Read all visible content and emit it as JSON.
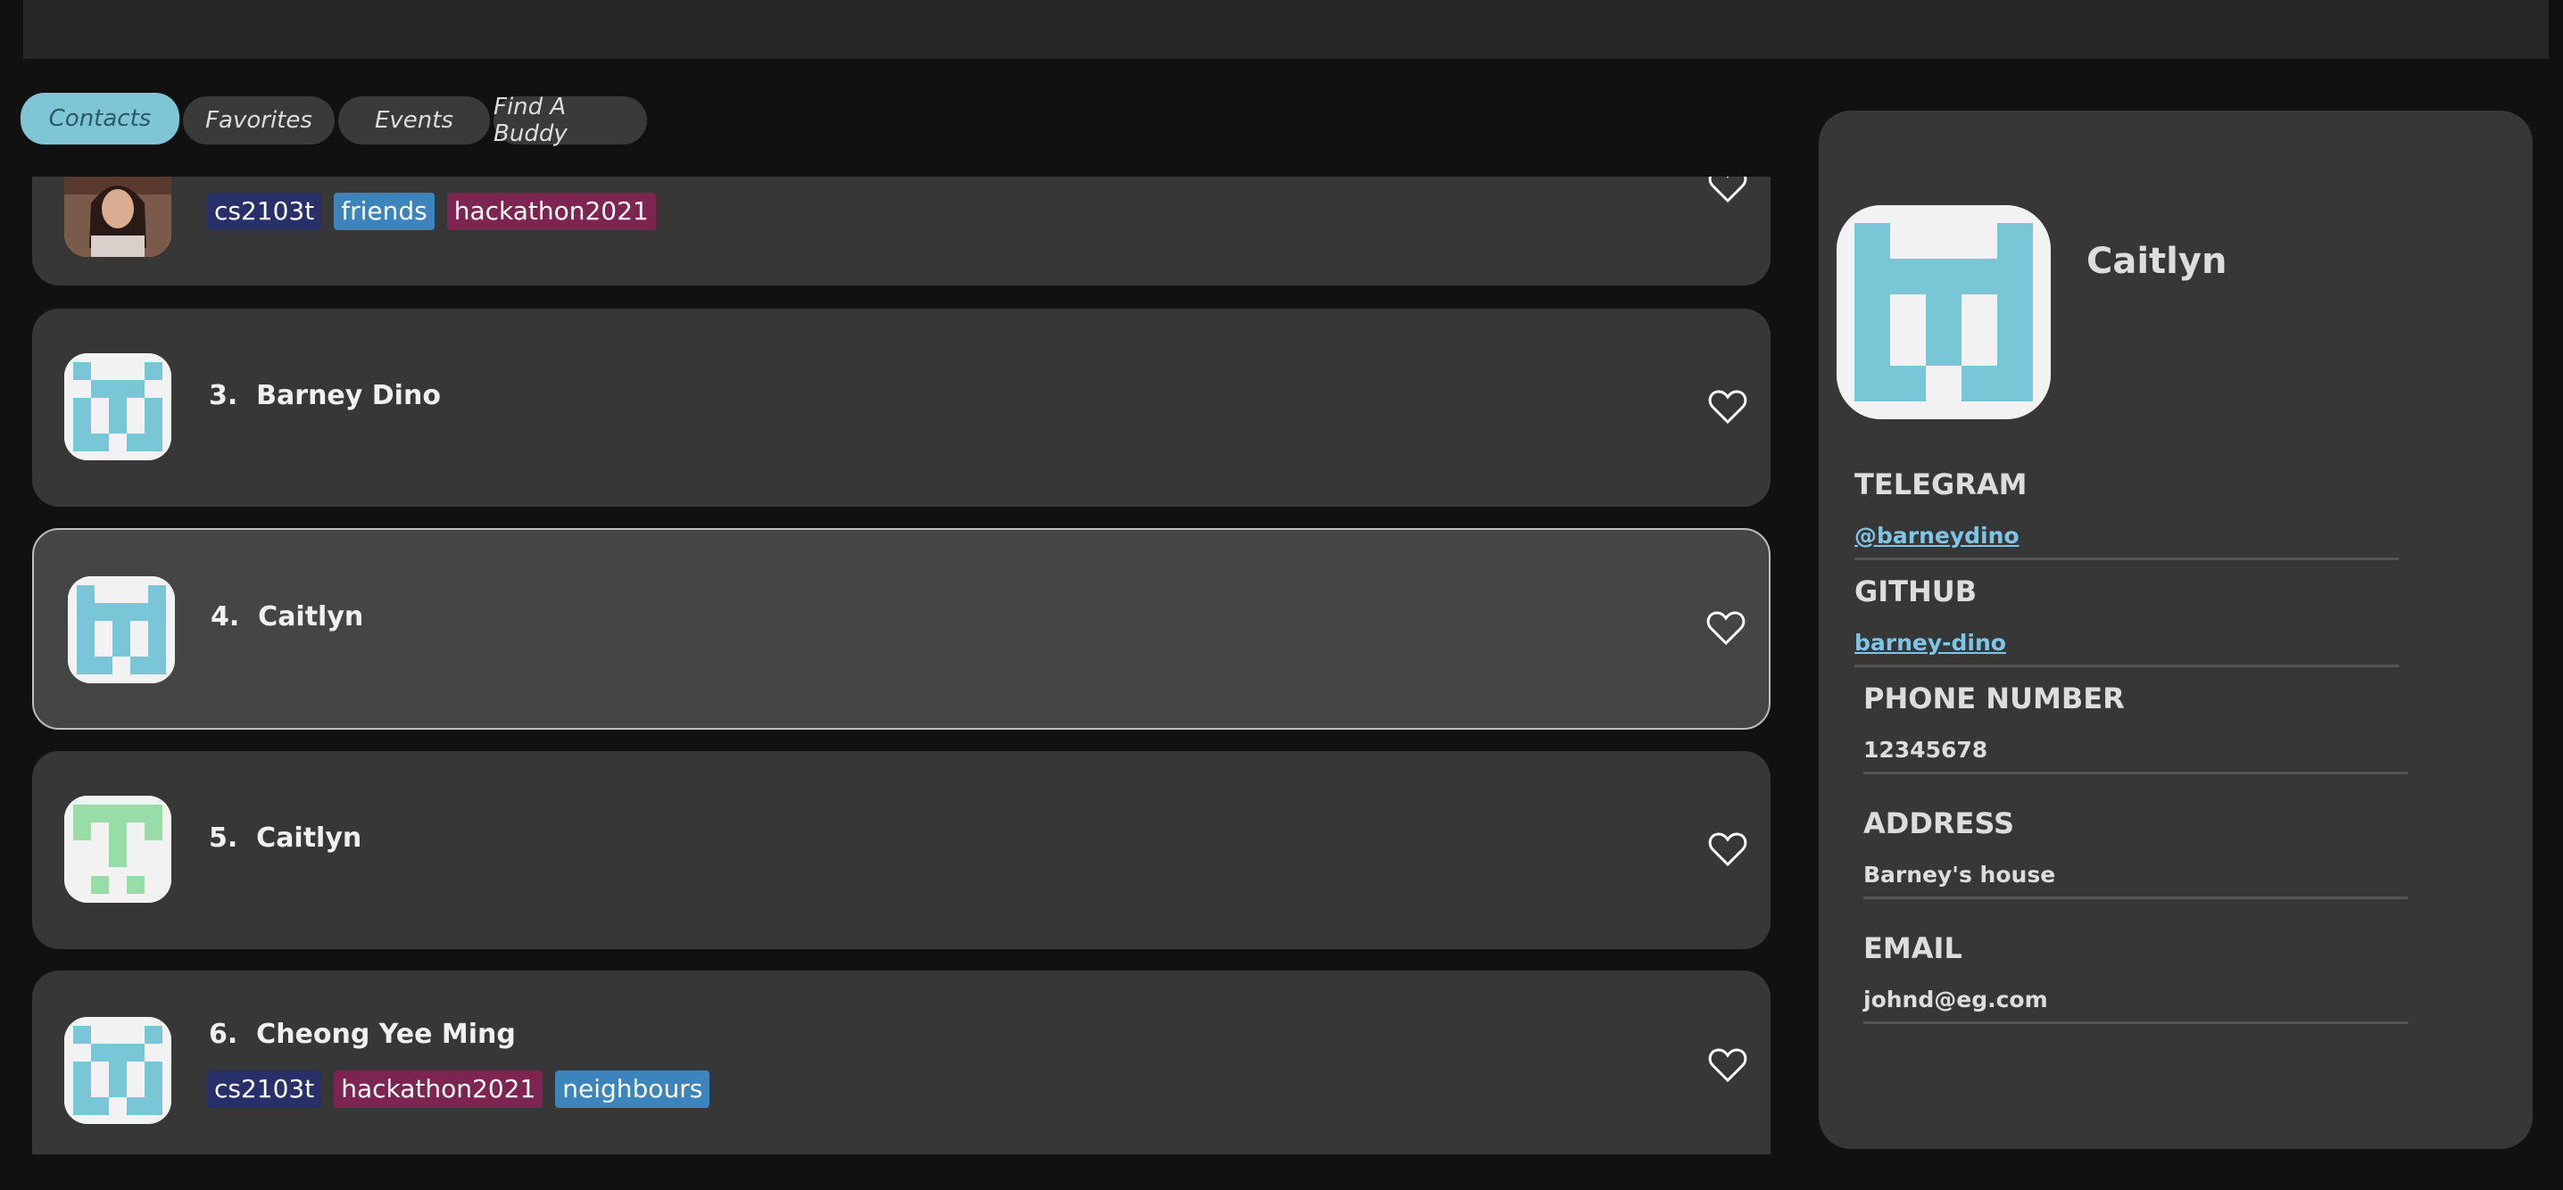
{
  "tabs": [
    {
      "label": "Contacts",
      "active": true
    },
    {
      "label": "Favorites",
      "active": false
    },
    {
      "label": "Events",
      "active": false
    },
    {
      "label": "Find A Buddy",
      "active": false
    }
  ],
  "contacts": [
    {
      "index": "",
      "name": "",
      "tags": [
        "cs2103t",
        "friends",
        "hackathon2021"
      ],
      "avatar": "photo-avatar"
    },
    {
      "index": "3.",
      "name": "Barney Dino",
      "tags": [],
      "avatar": "identicon-blue"
    },
    {
      "index": "4.",
      "name": "Caitlyn",
      "tags": [],
      "avatar": "identicon-blue",
      "selected": true
    },
    {
      "index": "5.",
      "name": "Caitlyn",
      "tags": [],
      "avatar": "identicon-green"
    },
    {
      "index": "6.",
      "name": "Cheong Yee Ming",
      "tags": [
        "cs2103t",
        "hackathon2021",
        "neighbours"
      ],
      "avatar": "identicon-blue"
    }
  ],
  "detail": {
    "name": "Caitlyn",
    "telegram_label": "TELEGRAM",
    "telegram": "@barneydino",
    "github_label": "GITHUB",
    "github": "barney-dino",
    "phone_label": "PHONE NUMBER",
    "phone": "12345678",
    "address_label": "ADDRESS",
    "address": "Barney's house",
    "email_label": "EMAIL",
    "email": "johnd@eg.com"
  },
  "colors": {
    "accent": "#7ec6d6",
    "identicon_blue": "#79c6d6",
    "identicon_green": "#98dca8",
    "tag_navy": "#28306a",
    "tag_blue": "#3c84bc",
    "tag_maroon": "#7e2450"
  }
}
